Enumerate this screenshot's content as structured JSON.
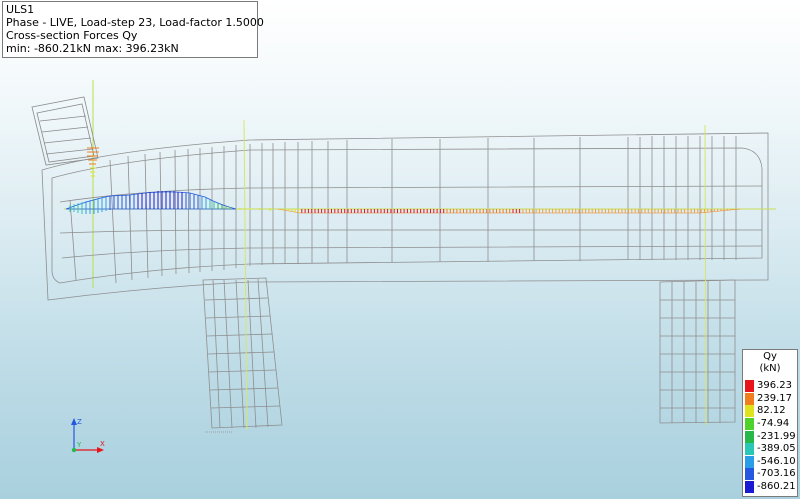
{
  "info": {
    "line1": "ULS1",
    "line2": "Phase - LIVE, Load-step 23, Load-factor 1.5000",
    "line3": "Cross-section Forces Qy",
    "line4": "min: -860.21kN max: 396.23kN"
  },
  "legend": {
    "title": "Qy",
    "unit": "(kN)",
    "entries": [
      {
        "value": "396.23",
        "color": "#e8141b"
      },
      {
        "value": "239.17",
        "color": "#f07d1e"
      },
      {
        "value": "82.12",
        "color": "#dfe31e"
      },
      {
        "value": "-74.94",
        "color": "#4fd22a"
      },
      {
        "value": "-231.99",
        "color": "#26b84a"
      },
      {
        "value": "-389.05",
        "color": "#29c7b6"
      },
      {
        "value": "-546.10",
        "color": "#2a9fe8"
      },
      {
        "value": "-703.16",
        "color": "#2458e0"
      },
      {
        "value": "-860.21",
        "color": "#1a1ad2"
      }
    ]
  },
  "axes": {
    "z": "Z",
    "y": "Y",
    "x": "X"
  }
}
